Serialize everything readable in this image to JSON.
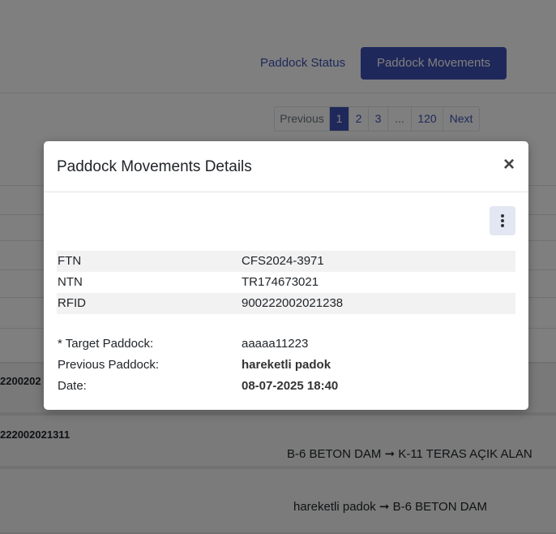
{
  "tabs": {
    "status_label": "Paddock Status",
    "movements_label": "Paddock Movements"
  },
  "pagination": {
    "previous": "Previous",
    "pages": [
      "1",
      "2",
      "3",
      "...",
      "120"
    ],
    "active_page": "1",
    "next": "Next"
  },
  "background_rows": {
    "rfid_1": "2200202",
    "rfid_2": "222002021311",
    "movement_1": "B-6 BETON DAM ➞ K-11 TERAS AÇIK ALAN",
    "movement_2": "hareketli padok ➞ B-6 BETON DAM"
  },
  "modal": {
    "title": "Paddock Movements Details",
    "close_symbol": "×",
    "identifiers": [
      {
        "label": "FTN",
        "value": "CFS2024-3971"
      },
      {
        "label": "NTN",
        "value": "TR174673021"
      },
      {
        "label": "RFID",
        "value": "900222002021238"
      }
    ],
    "movement": {
      "target_label": "* Target Paddock:",
      "target_value": "aaaaa11223",
      "previous_label": "Previous Paddock:",
      "previous_value": "hareketli padok",
      "date_label": "Date:",
      "date_value": "08-07-2025 18:40"
    }
  },
  "colors": {
    "primary": "#3f51b5",
    "backdrop": "rgba(0,0,0,0.5)"
  }
}
